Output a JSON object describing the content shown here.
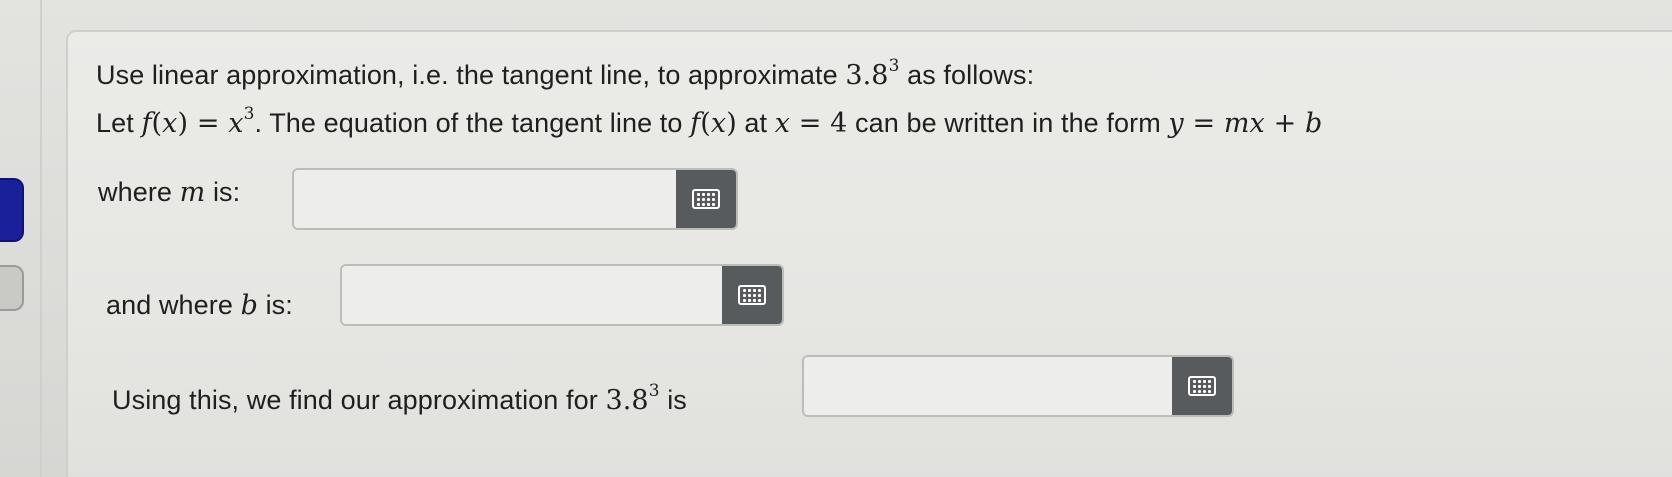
{
  "question": {
    "line1": {
      "text_before": "Use linear approximation, i.e. the tangent line, to approximate ",
      "base": "3.8",
      "exponent": "3",
      "text_after": " as follows:"
    },
    "line2": {
      "prefix": "Let ",
      "fx": "f",
      "paren_open": "(",
      "x1": "x",
      "paren_close_eq": ") = ",
      "x2": "x",
      "exp": "3",
      "middle": ". The equation of the tangent line to ",
      "fx2": "f",
      "paren_open2": "(",
      "x3": "x",
      "paren_close2": ")",
      "at": " at ",
      "x4": "x",
      "eq4": " = 4",
      "form_text": " can be written in the form ",
      "y": "y",
      "eq": " = ",
      "mx": "mx",
      "plus": " + ",
      "b": "b"
    }
  },
  "fields": {
    "m": {
      "label_before": "where ",
      "var": "m",
      "label_after": " is:",
      "value": "",
      "placeholder": ""
    },
    "b": {
      "label_before": "and where ",
      "var": "b",
      "label_after": " is:",
      "value": "",
      "placeholder": ""
    },
    "approx": {
      "label_before": "Using this, we find our approximation for ",
      "base": "3.8",
      "exponent": "3",
      "label_after": " is",
      "value": "",
      "placeholder": ""
    }
  },
  "icons": {
    "keyboard": "keyboard-icon"
  },
  "colors": {
    "side_tab_active": "#1a1f9a",
    "keyboard_button": "#585b5e"
  }
}
